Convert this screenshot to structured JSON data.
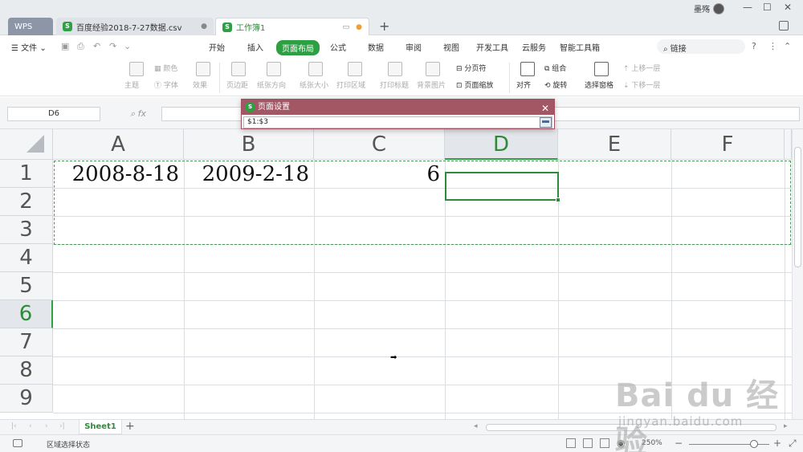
{
  "titlebar": {
    "tabs": [
      {
        "label": "WPS"
      },
      {
        "label": "百度经验2018-7-27数据.csv"
      },
      {
        "label": "工作簿1"
      }
    ],
    "user_name": "墨殇"
  },
  "menu": {
    "file_label": "文件",
    "tabs": [
      "开始",
      "插入",
      "页面布局",
      "公式",
      "数据",
      "审阅",
      "视图",
      "开发工具",
      "云服务",
      "智能工具箱"
    ],
    "active_tab": "页面布局",
    "search_placeholder": "链接"
  },
  "ribbon": {
    "theme": "主题",
    "colors": "颜色",
    "fonts": "字体",
    "effects": "效果",
    "margins": "页边距",
    "orientation": "纸张方向",
    "size": "纸张大小",
    "print_area": "打印区域",
    "print_titles": "打印标题",
    "background": "背景图片",
    "page_break": "分页符",
    "page_zoom": "页面缩放",
    "align": "对齐",
    "group": "组合",
    "rotate": "旋转",
    "selection_pane": "选择窗格",
    "bring_forward": "上移一层",
    "send_backward": "下移一层"
  },
  "formula_bar": {
    "cell_ref": "D6",
    "fx": "fx"
  },
  "grid": {
    "columns": [
      "A",
      "B",
      "C",
      "D",
      "E",
      "F"
    ],
    "selected_column": "D",
    "rows": [
      "1",
      "2",
      "3",
      "4",
      "5",
      "6",
      "7",
      "8",
      "9"
    ],
    "selected_row": "6",
    "cells": {
      "A1": "2008-8-18",
      "B1": "2009-2-18",
      "C1": "6"
    }
  },
  "dialog": {
    "title": "页面设置",
    "input_value": "$1:$3"
  },
  "sheets": {
    "active": "Sheet1"
  },
  "status": {
    "mode_text": "区域选择状态",
    "zoom": "250%"
  },
  "watermark": {
    "brand": "Bai du 经验",
    "url": "jingyan.baidu.com"
  },
  "colors": {
    "accent": "#2ea043",
    "dialog_header": "#a35663",
    "marquee": "#4a9a55"
  }
}
